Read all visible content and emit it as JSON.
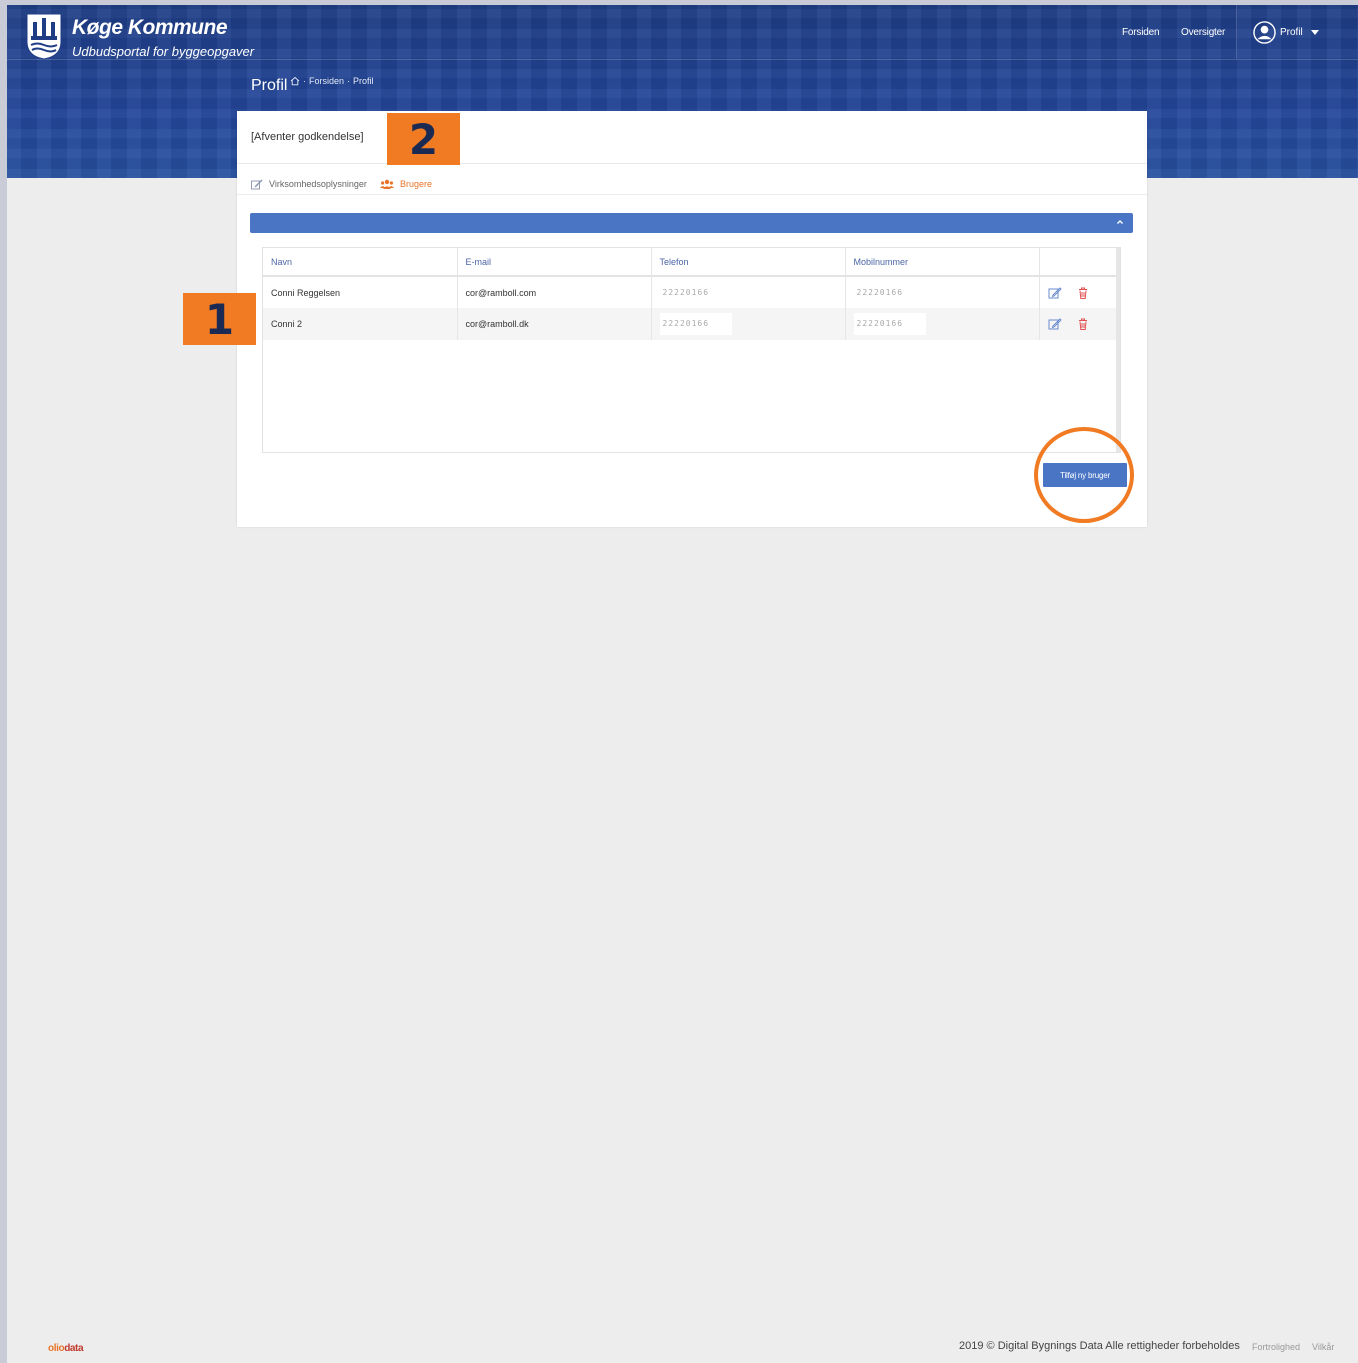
{
  "brand": {
    "name": "Køge Kommune",
    "subtitle": "Udbudsportal for byggeopgaver"
  },
  "nav": {
    "forsiden": "Forsiden",
    "oversigter": "Oversigter",
    "profile": "Profil"
  },
  "page": {
    "title": "Profil",
    "breadcrumb": [
      "Forsiden",
      "Profil"
    ]
  },
  "card": {
    "status": "[Afventer godkendelse]",
    "tabs": [
      {
        "label": "Virksomhedsoplysninger",
        "active": false
      },
      {
        "label": "Brugere",
        "active": true
      }
    ]
  },
  "table": {
    "headers": [
      "Navn",
      "E-mail",
      "Telefon",
      "Mobilnummer"
    ],
    "rows": [
      {
        "navn": "Conni Reggelsen",
        "email": "cor@ramboll.com",
        "telefon": "22220166",
        "mobil": "22220166"
      },
      {
        "navn": "Conni 2",
        "email": "cor@ramboll.dk",
        "telefon": "22220166",
        "mobil": "22220166"
      }
    ]
  },
  "actions": {
    "add_user": "Tilføj ny bruger"
  },
  "callouts": {
    "one": "1",
    "two": "2"
  },
  "footer": {
    "logo_a": "olio",
    "logo_b": "data",
    "copyright": "2019 © Digital Bygnings Data Alle rettigheder forbeholdes",
    "privacy": "Fortrolighed",
    "terms": "Vilkår"
  },
  "colors": {
    "primary": "#4a75c5",
    "header": "#23469a",
    "accent": "#e8742a",
    "callout": "#f07b23",
    "delete": "#e05050"
  }
}
